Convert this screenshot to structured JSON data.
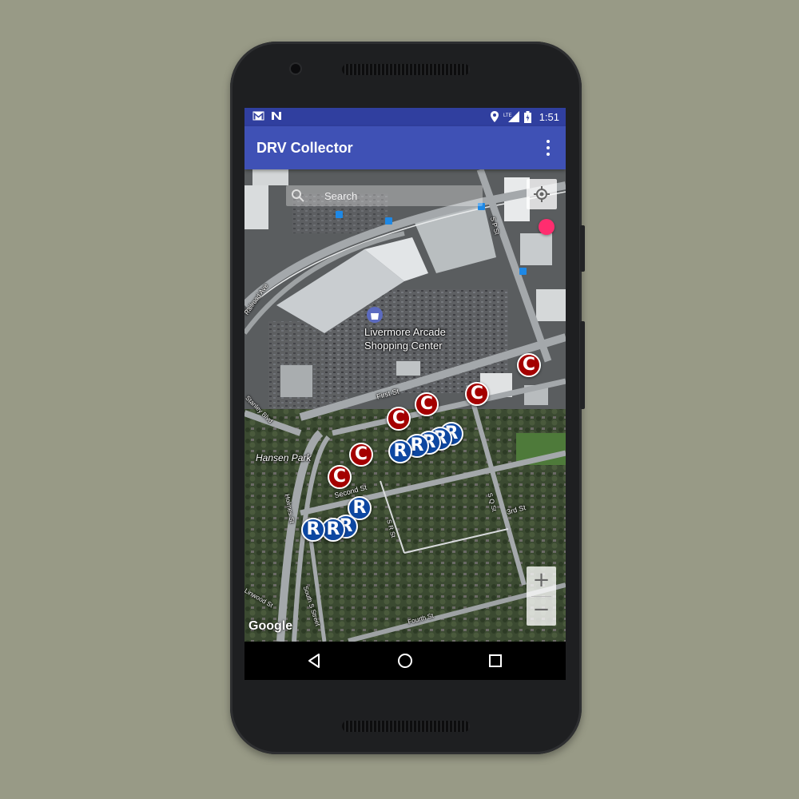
{
  "status_bar": {
    "time": "1:51",
    "left_icons": [
      "gmail-icon",
      "notification-n-icon"
    ],
    "right_icons": [
      "location-icon",
      "lte-signal-icon",
      "battery-icon"
    ]
  },
  "app_bar": {
    "title": "DRV Collector",
    "menu_icon": "overflow-menu-icon"
  },
  "map": {
    "search": {
      "placeholder": "Search",
      "value": ""
    },
    "labels": {
      "poi_line1": "Livermore Arcade",
      "poi_line2": "Shopping Center",
      "park": "Hansen Park",
      "first_st": "First St",
      "second_st": "Second St",
      "third_st": "3rd St",
      "fourth_st": "Fourth St",
      "holmes_st": "Holmes St",
      "south_s_st": "South S Street",
      "s_r_st": "S R St",
      "s_q_st": "S Q St",
      "s_p_st": "S P St",
      "railroad_ave": "Railroad Ave",
      "stanley_blvd": "Stanley Blvd",
      "linwood": "Linwood St"
    },
    "attribution": "Google",
    "zoom": {
      "in": "+",
      "out": "−"
    },
    "marker_letter_c": "C",
    "marker_letter_r": "R",
    "marker_colors": {
      "c": "#a40000",
      "r": "#0d47a1"
    },
    "location_dot_color": "#ff2d6f"
  },
  "nav_bar": {
    "icons": [
      "back-icon",
      "home-icon",
      "recents-icon"
    ]
  }
}
